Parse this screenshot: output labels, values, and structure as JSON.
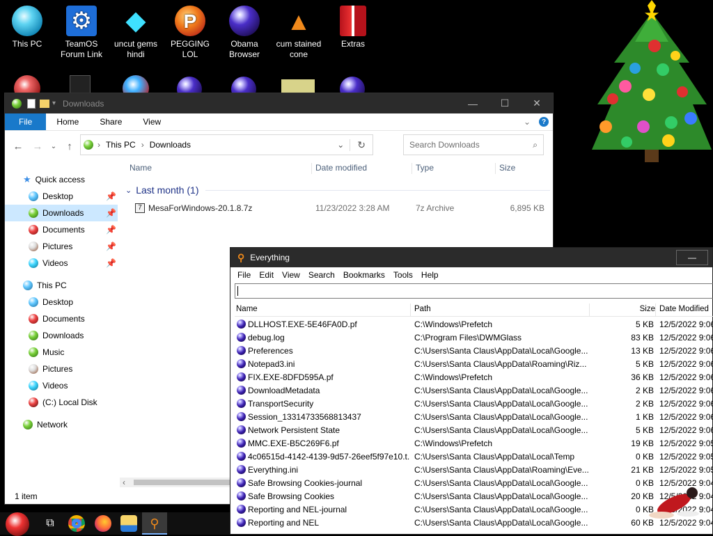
{
  "desktop": {
    "icons": [
      {
        "label": "This PC"
      },
      {
        "label": "TeamOS Forum Link"
      },
      {
        "label": "uncut gems hindi"
      },
      {
        "label": "PEGGING LOL"
      },
      {
        "label": "Obama Browser"
      },
      {
        "label": "cum stained cone"
      },
      {
        "label": "Extras"
      }
    ]
  },
  "explorer": {
    "title": "Downloads",
    "ribbon_tabs": [
      "File",
      "Home",
      "Share",
      "View"
    ],
    "address": {
      "root": "This PC",
      "sep": ">",
      "current": "Downloads"
    },
    "search_placeholder": "Search Downloads",
    "nav": {
      "quick_access": "Quick access",
      "qa_items": [
        "Desktop",
        "Downloads",
        "Documents",
        "Pictures",
        "Videos"
      ],
      "this_pc": "This PC",
      "pc_items": [
        "Desktop",
        "Documents",
        "Downloads",
        "Music",
        "Pictures",
        "Videos",
        "(C:) Local Disk"
      ],
      "network": "Network"
    },
    "columns": {
      "name": "Name",
      "date": "Date modified",
      "type": "Type",
      "size": "Size"
    },
    "group": "Last month (1)",
    "files": [
      {
        "name": "MesaForWindows-20.1.8.7z",
        "date": "11/23/2022 3:28 AM",
        "type": "7z Archive",
        "size": "6,895 KB"
      }
    ],
    "status": "1 item"
  },
  "everything": {
    "title": "Everything",
    "menu": [
      "File",
      "Edit",
      "View",
      "Search",
      "Bookmarks",
      "Tools",
      "Help"
    ],
    "search_value": "",
    "columns": {
      "name": "Name",
      "path": "Path",
      "size": "Size",
      "date": "Date Modified"
    },
    "rows": [
      {
        "name": "DLLHOST.EXE-5E46FA0D.pf",
        "path": "C:\\Windows\\Prefetch",
        "size": "5 KB",
        "date": "12/5/2022 9:06"
      },
      {
        "name": "debug.log",
        "path": "C:\\Program Files\\DWMGlass",
        "size": "83 KB",
        "date": "12/5/2022 9:06"
      },
      {
        "name": "Preferences",
        "path": "C:\\Users\\Santa Claus\\AppData\\Local\\Google...",
        "size": "13 KB",
        "date": "12/5/2022 9:06"
      },
      {
        "name": "Notepad3.ini",
        "path": "C:\\Users\\Santa Claus\\AppData\\Roaming\\Riz...",
        "size": "5 KB",
        "date": "12/5/2022 9:06"
      },
      {
        "name": "FIX.EXE-8DFD595A.pf",
        "path": "C:\\Windows\\Prefetch",
        "size": "36 KB",
        "date": "12/5/2022 9:06"
      },
      {
        "name": "DownloadMetadata",
        "path": "C:\\Users\\Santa Claus\\AppData\\Local\\Google...",
        "size": "2 KB",
        "date": "12/5/2022 9:06"
      },
      {
        "name": "TransportSecurity",
        "path": "C:\\Users\\Santa Claus\\AppData\\Local\\Google...",
        "size": "2 KB",
        "date": "12/5/2022 9:06"
      },
      {
        "name": "Session_13314733568813437",
        "path": "C:\\Users\\Santa Claus\\AppData\\Local\\Google...",
        "size": "1 KB",
        "date": "12/5/2022 9:06"
      },
      {
        "name": "Network Persistent State",
        "path": "C:\\Users\\Santa Claus\\AppData\\Local\\Google...",
        "size": "5 KB",
        "date": "12/5/2022 9:06"
      },
      {
        "name": "MMC.EXE-B5C269F6.pf",
        "path": "C:\\Windows\\Prefetch",
        "size": "19 KB",
        "date": "12/5/2022 9:05"
      },
      {
        "name": "4c06515d-4142-4139-9d57-26eef5f97e10.t...",
        "path": "C:\\Users\\Santa Claus\\AppData\\Local\\Temp",
        "size": "0 KB",
        "date": "12/5/2022 9:05"
      },
      {
        "name": "Everything.ini",
        "path": "C:\\Users\\Santa Claus\\AppData\\Roaming\\Eve...",
        "size": "21 KB",
        "date": "12/5/2022 9:05"
      },
      {
        "name": "Safe Browsing Cookies-journal",
        "path": "C:\\Users\\Santa Claus\\AppData\\Local\\Google...",
        "size": "0 KB",
        "date": "12/5/2022 9:04"
      },
      {
        "name": "Safe Browsing Cookies",
        "path": "C:\\Users\\Santa Claus\\AppData\\Local\\Google...",
        "size": "20 KB",
        "date": "12/5/2022 9:04"
      },
      {
        "name": "Reporting and NEL-journal",
        "path": "C:\\Users\\Santa Claus\\AppData\\Local\\Google...",
        "size": "0 KB",
        "date": "12/5/2022 9:04"
      },
      {
        "name": "Reporting and NEL",
        "path": "C:\\Users\\Santa Claus\\AppData\\Local\\Google...",
        "size": "60 KB",
        "date": "12/5/2022 9:04"
      }
    ]
  },
  "colors": {
    "accent": "#0078d7",
    "selection": "#cce8ff",
    "titlebar": "#2b2b2b"
  }
}
